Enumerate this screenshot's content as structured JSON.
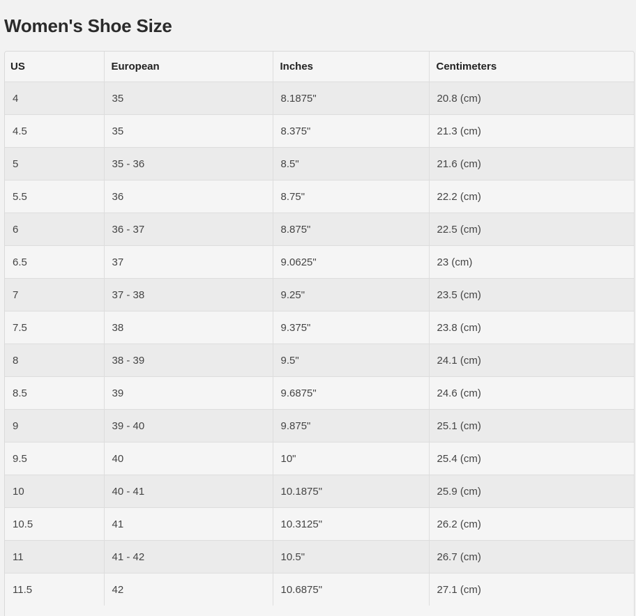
{
  "page": {
    "title": "Women's Shoe Size"
  },
  "table": {
    "headers": [
      "US",
      "European",
      "Inches",
      "Centimeters"
    ],
    "rows": [
      [
        "4",
        "35",
        "8.1875\"",
        "20.8 (cm)"
      ],
      [
        "4.5",
        "35",
        "8.375\"",
        "21.3 (cm)"
      ],
      [
        "5",
        "35 - 36",
        "8.5\"",
        "21.6 (cm)"
      ],
      [
        "5.5",
        "36",
        "8.75\"",
        "22.2 (cm)"
      ],
      [
        "6",
        "36 - 37",
        "8.875\"",
        "22.5 (cm)"
      ],
      [
        "6.5",
        "37",
        "9.0625\"",
        "23 (cm)"
      ],
      [
        "7",
        "37 - 38",
        "9.25\"",
        "23.5 (cm)"
      ],
      [
        "7.5",
        "38",
        "9.375\"",
        "23.8 (cm)"
      ],
      [
        "8",
        "38 - 39",
        "9.5\"",
        "24.1 (cm)"
      ],
      [
        "8.5",
        "39",
        "9.6875\"",
        "24.6 (cm)"
      ],
      [
        "9",
        "39 - 40",
        "9.875\"",
        "25.1 (cm)"
      ],
      [
        "9.5",
        "40",
        "10\"",
        "25.4 (cm)"
      ],
      [
        "10",
        "40 - 41",
        "10.1875\"",
        "25.9 (cm)"
      ],
      [
        "10.5",
        "41",
        "10.3125\"",
        "26.2 (cm)"
      ],
      [
        "11",
        "41 - 42",
        "10.5\"",
        "26.7 (cm)"
      ],
      [
        "11.5",
        "42",
        "10.6875\"",
        "27.1 (cm)"
      ]
    ]
  }
}
